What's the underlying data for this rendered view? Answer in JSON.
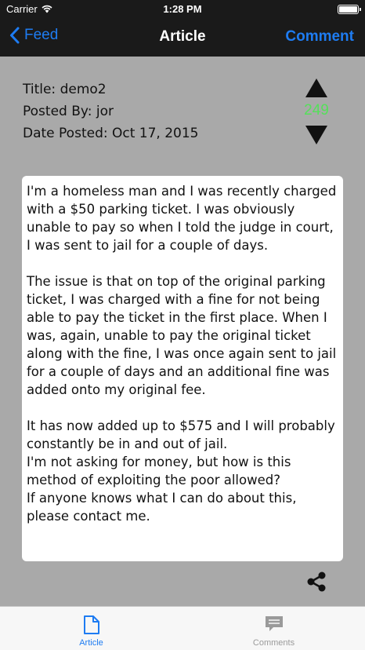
{
  "status_bar": {
    "carrier": "Carrier",
    "time": "1:28 PM"
  },
  "nav": {
    "back_label": "Feed",
    "title": "Article",
    "right_label": "Comment"
  },
  "meta": {
    "title": "Title: demo2",
    "posted_by": "Posted By: jor",
    "date_posted": "Date Posted: Oct 17, 2015"
  },
  "vote": {
    "score": "249"
  },
  "article": {
    "paragraphs": [
      "I'm a homeless man and I was recently charged with a $50 parking ticket. I was obviously unable to pay so when I told the judge in court, I was sent to jail for a couple of days.",
      "The issue is that on top of the original parking ticket, I was charged with a fine for not being able to pay the ticket in the first place. When I was, again, unable to pay the original ticket along with the fine, I was once again sent to jail for a couple of days and an additional fine was added onto my original fee.",
      "It has now added up to $575 and I will probably constantly be in and out of jail.\nI'm not asking for money, but how is this method of exploiting the poor allowed?\nIf anyone knows what I can do about this, please contact me."
    ]
  },
  "tabs": [
    {
      "label": "Article",
      "icon": "document-icon",
      "active": true
    },
    {
      "label": "Comments",
      "icon": "chat-bubble-icon",
      "active": false
    }
  ],
  "colors": {
    "accent": "#1e7cf2",
    "score": "#55e05a",
    "inactive_tab": "#9a9a9a",
    "background": "#a9a9a9",
    "bar": "#1a1a1a"
  }
}
